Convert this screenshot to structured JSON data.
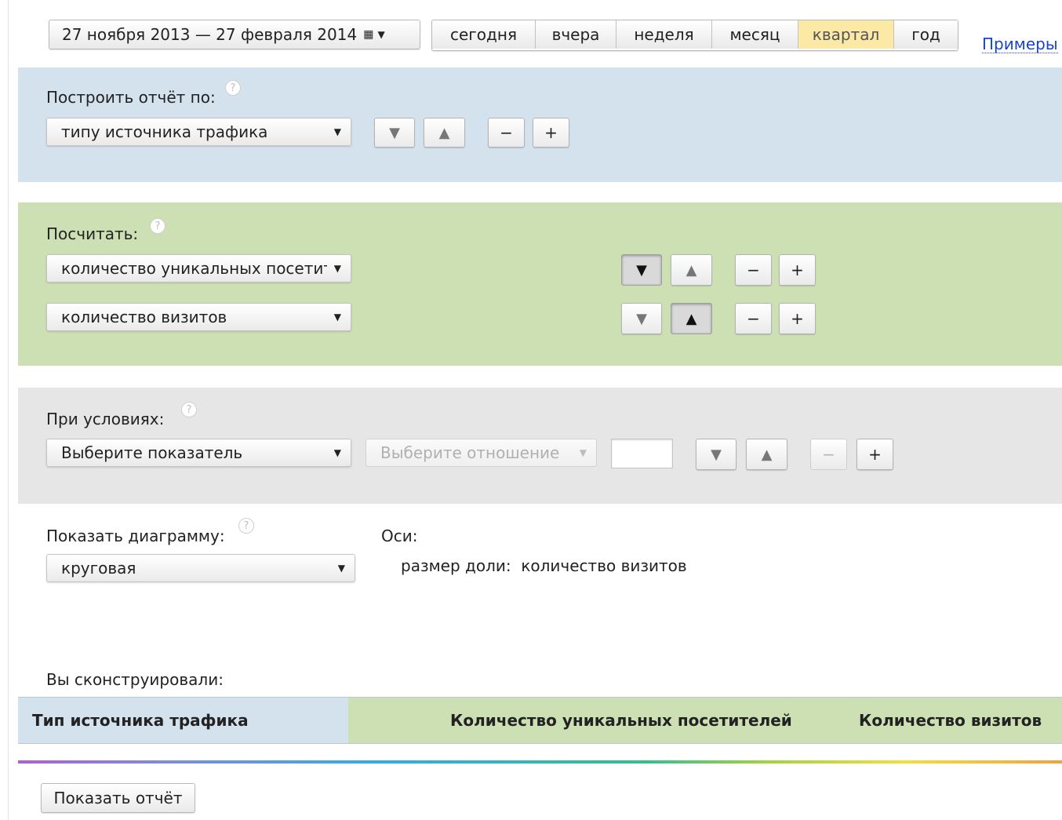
{
  "top": {
    "date_range": "27 ноября 2013 — 27 февраля 2014",
    "calendar_icon": "calendar-icon",
    "periods": [
      "сегодня",
      "вчера",
      "неделя",
      "месяц",
      "квартал",
      "год"
    ],
    "active_period": "квартал",
    "examples_link": "Примеры"
  },
  "build": {
    "label": "Построить отчёт по:",
    "select_value": "типу источника трафика"
  },
  "count": {
    "label": "Посчитать:",
    "rows": [
      {
        "value": "количество уникальных посетителей"
      },
      {
        "value": "количество визитов"
      }
    ]
  },
  "conditions": {
    "label": "При условиях:",
    "metric_value": "Выберите показатель",
    "relation_placeholder": "Выберите отношение",
    "input_value": ""
  },
  "chart": {
    "label": "Показать диаграмму:",
    "select_value": "круговая",
    "axes_label": "Оси:",
    "axis_text": "размер доли:  количество визитов"
  },
  "result": {
    "label": "Вы сконструировали:",
    "columns": [
      "Тип источника трафика",
      "Количество уникальных посетителей",
      "Количество визитов"
    ]
  },
  "controls": {
    "down": "▼",
    "up": "▲",
    "minus": "−",
    "plus": "+",
    "help": "?",
    "caret": "▼"
  },
  "submit_label": "Показать отчёт",
  "colors": {
    "build_panel": "#d4e2ee",
    "count_panel": "#cde0b4",
    "conditions_panel": "#e6e6e6",
    "active_period": "#fde9a6",
    "link": "#1a44c9"
  }
}
